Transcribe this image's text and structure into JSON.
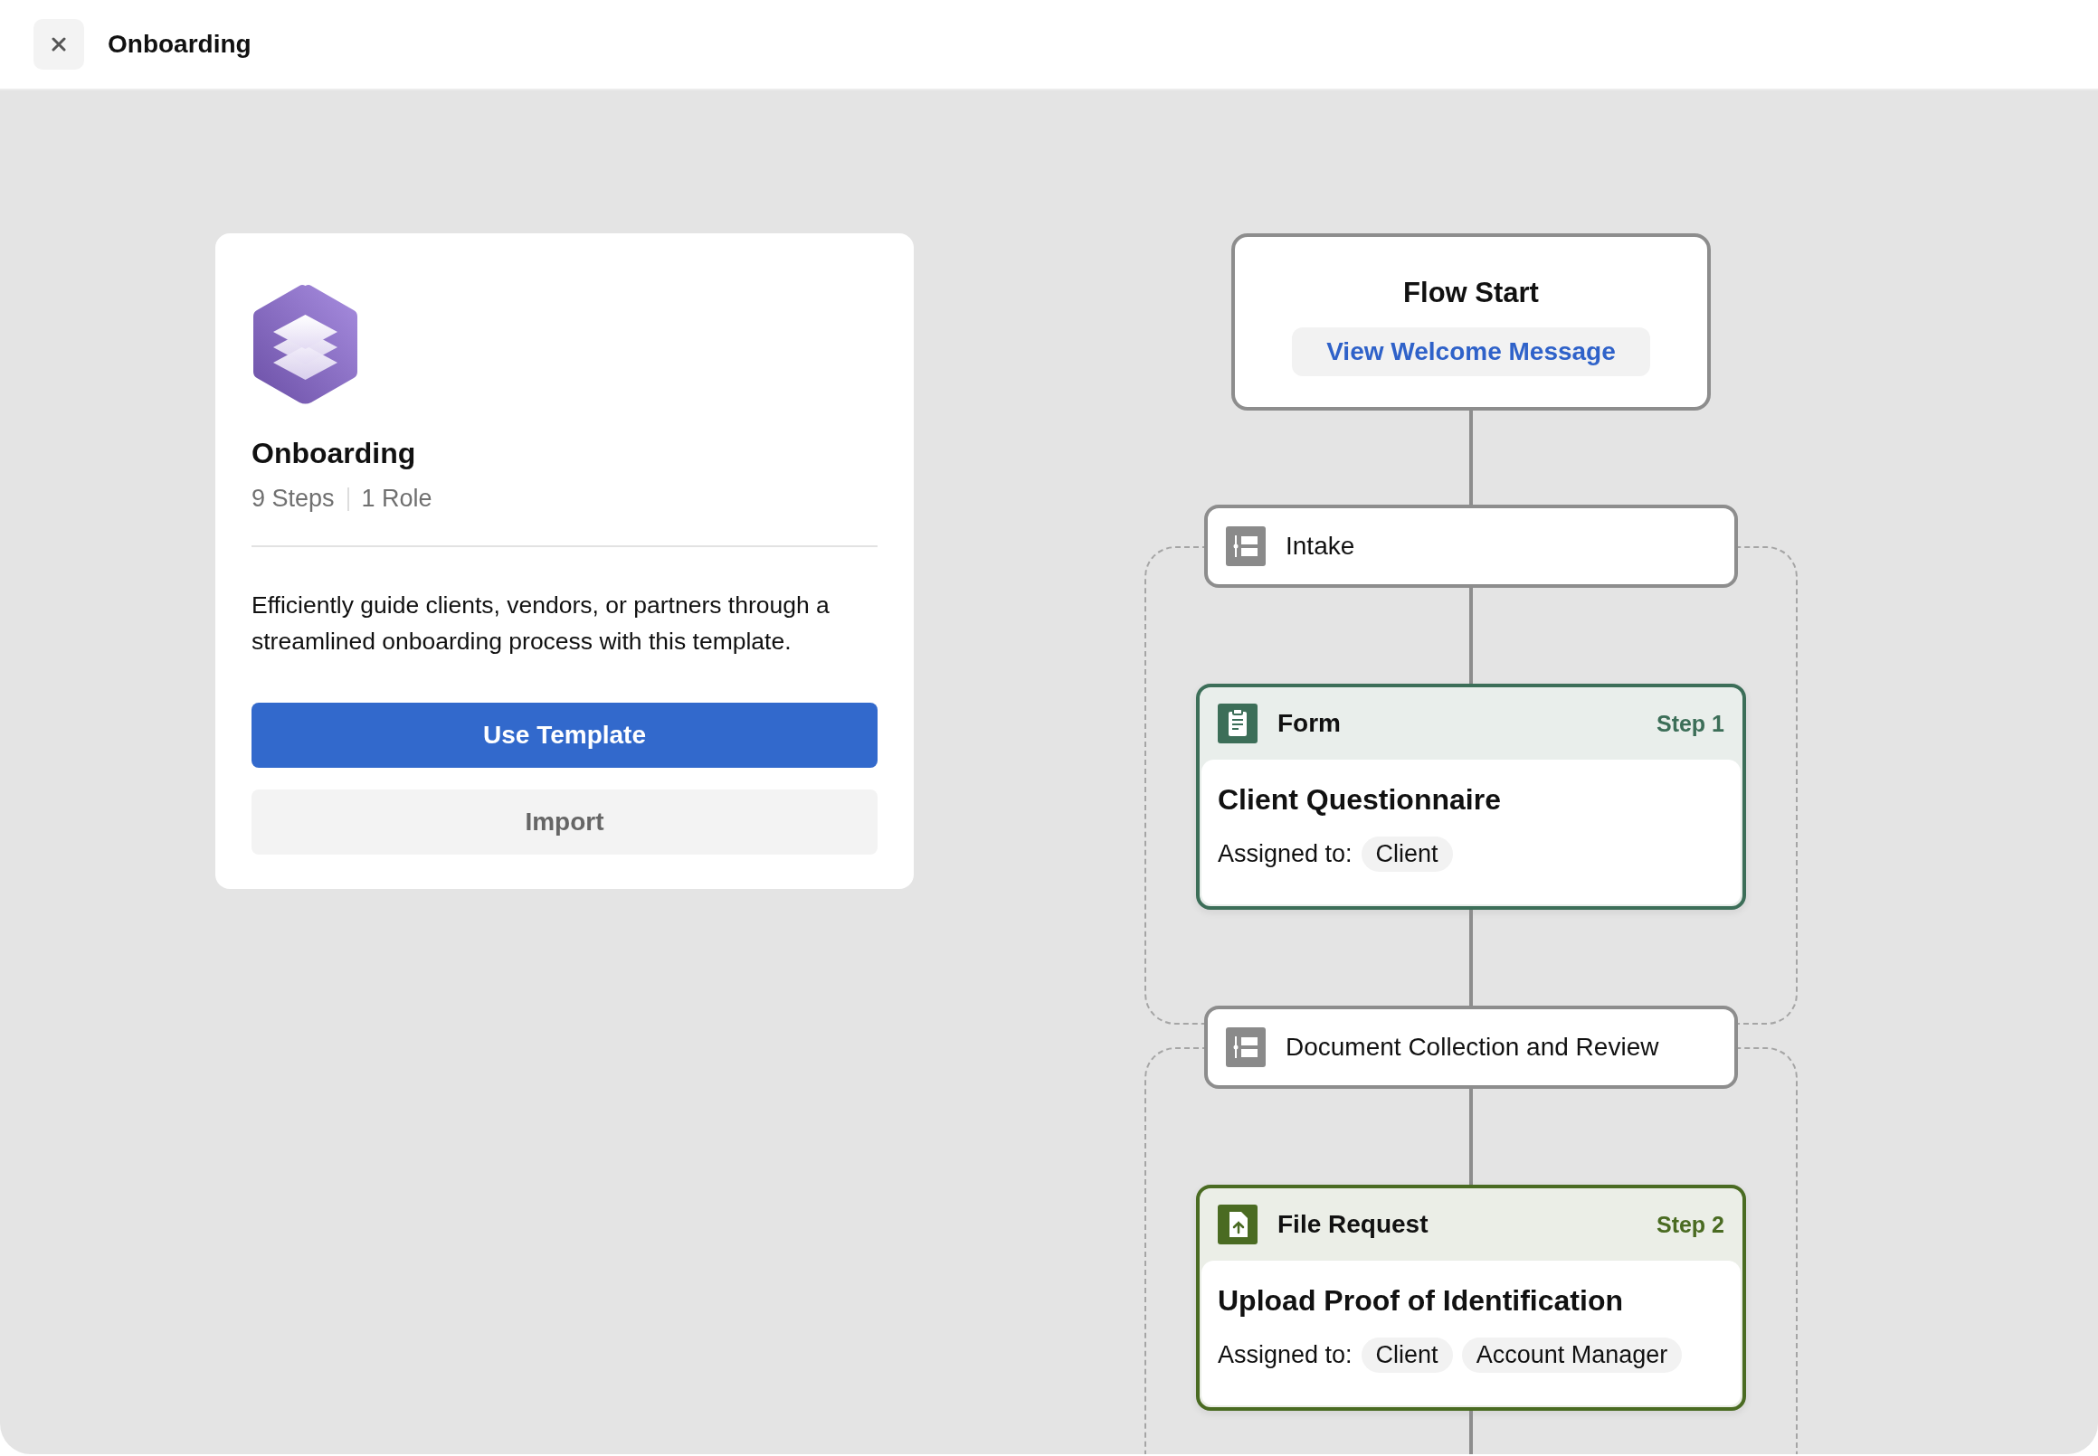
{
  "header": {
    "title": "Onboarding"
  },
  "template": {
    "title": "Onboarding",
    "meta": [
      "9 Steps",
      "1 Role"
    ],
    "description": "Efficiently guide clients, vendors, or partners through a streamlined onboarding process with this template.",
    "buttons": [
      {
        "label": "Use Template",
        "kind": "primary"
      },
      {
        "label": "Import",
        "kind": "secondary"
      }
    ]
  },
  "flow": {
    "start": {
      "title": "Flow Start",
      "action": "View Welcome Message"
    },
    "sections": [
      {
        "title": "Intake",
        "steps": [
          {
            "kind": "form",
            "type_label": "Form",
            "step": "Step 1",
            "title": "Client Questionnaire",
            "assigned_label": "Assigned to:",
            "assignees": [
              "Client"
            ]
          }
        ]
      },
      {
        "title": "Document Collection and Review",
        "steps": [
          {
            "kind": "file_request",
            "type_label": "File Request",
            "step": "Step 2",
            "title": "Upload Proof of Identification",
            "assigned_label": "Assigned to:",
            "assignees": [
              "Client",
              "Account Manager"
            ]
          }
        ]
      }
    ]
  }
}
